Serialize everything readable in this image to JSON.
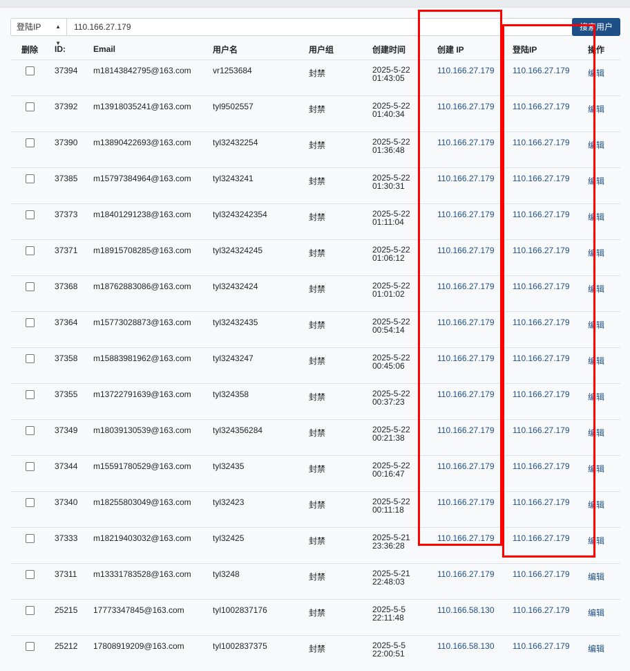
{
  "search": {
    "field_select": "登陆IP",
    "query": "110.166.27.179",
    "button_label": "搜索用户"
  },
  "table": {
    "headers": [
      "删除",
      "ID:",
      "Email",
      "用户名",
      "用户组",
      "创建时间",
      "创建 IP",
      "登陆IP",
      "操作"
    ],
    "rows": [
      {
        "id": "37394",
        "email": "m18143842795@163.com",
        "username": "vr1253684",
        "group": "封禁",
        "date": "2025-5-22",
        "time": "01:43:05",
        "create_ip": "110.166.27.179",
        "login_ip": "110.166.27.179",
        "action": "编辑"
      },
      {
        "id": "37392",
        "email": "m13918035241@163.com",
        "username": "tyl9502557",
        "group": "封禁",
        "date": "2025-5-22",
        "time": "01:40:34",
        "create_ip": "110.166.27.179",
        "login_ip": "110.166.27.179",
        "action": "编辑"
      },
      {
        "id": "37390",
        "email": "m13890422693@163.com",
        "username": "tyl32432254",
        "group": "封禁",
        "date": "2025-5-22",
        "time": "01:36:48",
        "create_ip": "110.166.27.179",
        "login_ip": "110.166.27.179",
        "action": "编辑"
      },
      {
        "id": "37385",
        "email": "m15797384964@163.com",
        "username": "tyl3243241",
        "group": "封禁",
        "date": "2025-5-22",
        "time": "01:30:31",
        "create_ip": "110.166.27.179",
        "login_ip": "110.166.27.179",
        "action": "编辑"
      },
      {
        "id": "37373",
        "email": "m18401291238@163.com",
        "username": "tyl3243242354",
        "group": "封禁",
        "date": "2025-5-22",
        "time": "01:11:04",
        "create_ip": "110.166.27.179",
        "login_ip": "110.166.27.179",
        "action": "编辑"
      },
      {
        "id": "37371",
        "email": "m18915708285@163.com",
        "username": "tyl324324245",
        "group": "封禁",
        "date": "2025-5-22",
        "time": "01:06:12",
        "create_ip": "110.166.27.179",
        "login_ip": "110.166.27.179",
        "action": "编辑"
      },
      {
        "id": "37368",
        "email": "m18762883086@163.com",
        "username": "tyl32432424",
        "group": "封禁",
        "date": "2025-5-22",
        "time": "01:01:02",
        "create_ip": "110.166.27.179",
        "login_ip": "110.166.27.179",
        "action": "编辑"
      },
      {
        "id": "37364",
        "email": "m15773028873@163.com",
        "username": "tyl32432435",
        "group": "封禁",
        "date": "2025-5-22",
        "time": "00:54:14",
        "create_ip": "110.166.27.179",
        "login_ip": "110.166.27.179",
        "action": "编辑"
      },
      {
        "id": "37358",
        "email": "m15883981962@163.com",
        "username": "tyl3243247",
        "group": "封禁",
        "date": "2025-5-22",
        "time": "00:45:06",
        "create_ip": "110.166.27.179",
        "login_ip": "110.166.27.179",
        "action": "编辑"
      },
      {
        "id": "37355",
        "email": "m13722791639@163.com",
        "username": "tyl324358",
        "group": "封禁",
        "date": "2025-5-22",
        "time": "00:37:23",
        "create_ip": "110.166.27.179",
        "login_ip": "110.166.27.179",
        "action": "编辑"
      },
      {
        "id": "37349",
        "email": "m18039130539@163.com",
        "username": "tyl324356284",
        "group": "封禁",
        "date": "2025-5-22",
        "time": "00:21:38",
        "create_ip": "110.166.27.179",
        "login_ip": "110.166.27.179",
        "action": "编辑"
      },
      {
        "id": "37344",
        "email": "m15591780529@163.com",
        "username": "tyl32435",
        "group": "封禁",
        "date": "2025-5-22",
        "time": "00:16:47",
        "create_ip": "110.166.27.179",
        "login_ip": "110.166.27.179",
        "action": "编辑"
      },
      {
        "id": "37340",
        "email": "m18255803049@163.com",
        "username": "tyl32423",
        "group": "封禁",
        "date": "2025-5-22",
        "time": "00:11:18",
        "create_ip": "110.166.27.179",
        "login_ip": "110.166.27.179",
        "action": "编辑"
      },
      {
        "id": "37333",
        "email": "m18219403032@163.com",
        "username": "tyl32425",
        "group": "封禁",
        "date": "2025-5-21",
        "time": "23:36:28",
        "create_ip": "110.166.27.179",
        "login_ip": "110.166.27.179",
        "action": "编辑"
      },
      {
        "id": "37311",
        "email": "m13331783528@163.com",
        "username": "tyl3248",
        "group": "封禁",
        "date": "2025-5-21",
        "time": "22:48:03",
        "create_ip": "110.166.27.179",
        "login_ip": "110.166.27.179",
        "action": "编辑"
      },
      {
        "id": "25215",
        "email": "17773347845@163.com",
        "username": "tyl1002837176",
        "group": "封禁",
        "date": "2025-5-5",
        "time": "22:11:48",
        "create_ip": "110.166.58.130",
        "login_ip": "110.166.27.179",
        "action": "编辑"
      },
      {
        "id": "25212",
        "email": "17808919209@163.com",
        "username": "tyl1002837375",
        "group": "封禁",
        "date": "2025-5-5",
        "time": "22:00:51",
        "create_ip": "110.166.58.130",
        "login_ip": "110.166.27.179",
        "action": "编辑"
      }
    ]
  },
  "colors": {
    "accent": "#1e4f86",
    "highlight": "#ff0000"
  }
}
